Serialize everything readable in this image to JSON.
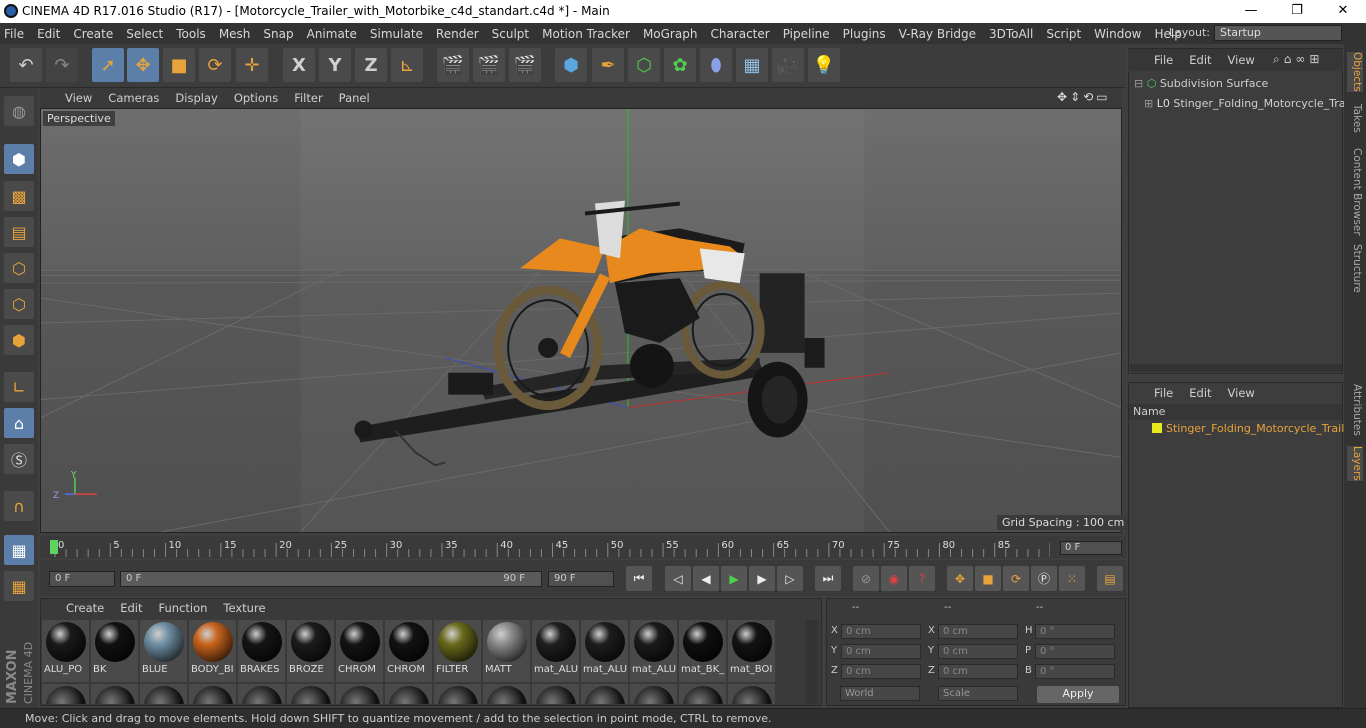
{
  "window": {
    "title": "CINEMA 4D R17.016 Studio (R17) - [Motorcycle_Trailer_with_Motorbike_c4d_standart.c4d *] - Main",
    "min": "—",
    "max": "❐",
    "close": "✕"
  },
  "menu": [
    "File",
    "Edit",
    "Create",
    "Select",
    "Tools",
    "Mesh",
    "Snap",
    "Animate",
    "Simulate",
    "Render",
    "Sculpt",
    "Motion Tracker",
    "MoGraph",
    "Character",
    "Pipeline",
    "Plugins",
    "V-Ray Bridge",
    "3DToAll",
    "Script",
    "Window",
    "Help"
  ],
  "layout": {
    "label": "Layout:",
    "value": "Startup"
  },
  "axes": {
    "x": "X",
    "y": "Y",
    "z": "Z"
  },
  "viewport": {
    "menu": [
      "View",
      "Cameras",
      "Display",
      "Options",
      "Filter",
      "Panel"
    ],
    "camera": "Perspective",
    "grid_spacing": "Grid Spacing : 100 cm",
    "axis_y": "Y",
    "axis_z": "Z"
  },
  "timeline": {
    "ticks": [
      "0",
      "5",
      "10",
      "15",
      "20",
      "25",
      "30",
      "35",
      "40",
      "45",
      "50",
      "55",
      "60",
      "65",
      "70",
      "75",
      "80",
      "85",
      "90"
    ],
    "current": "0 F",
    "start": "0 F",
    "range_start": "0 F",
    "range_end": "90 F",
    "end": "90 F"
  },
  "materials": {
    "menu": [
      "Create",
      "Edit",
      "Function",
      "Texture"
    ],
    "items": [
      {
        "name": "ALU_PO",
        "color": "#1a1a1a"
      },
      {
        "name": "BK",
        "color": "#111111"
      },
      {
        "name": "BLUE",
        "color": "#6f8fa3"
      },
      {
        "name": "BODY_BI",
        "color": "#c8641c"
      },
      {
        "name": "BRAKES",
        "color": "#151515"
      },
      {
        "name": "BROZE",
        "color": "#1c1c1c"
      },
      {
        "name": "CHROM",
        "color": "#141414"
      },
      {
        "name": "CHROM",
        "color": "#121212"
      },
      {
        "name": "FILTER",
        "color": "#6a6a1c"
      },
      {
        "name": "MATT",
        "color": "#8a8a8a"
      },
      {
        "name": "mat_ALU",
        "color": "#202020"
      },
      {
        "name": "mat_ALU",
        "color": "#1e1e1e"
      },
      {
        "name": "mat_ALU",
        "color": "#1b1b1b"
      },
      {
        "name": "mat_BK_",
        "color": "#0f0f0f"
      },
      {
        "name": "mat_BOI",
        "color": "#131313"
      }
    ]
  },
  "coords": {
    "hdr": [
      "--",
      "--",
      "--"
    ],
    "rows": [
      {
        "a": "X",
        "av": "0 cm",
        "b": "X",
        "bv": "0 cm",
        "c": "H",
        "cv": "0 °"
      },
      {
        "a": "Y",
        "av": "0 cm",
        "b": "Y",
        "bv": "0 cm",
        "c": "P",
        "cv": "0 °"
      },
      {
        "a": "Z",
        "av": "0 cm",
        "b": "Z",
        "bv": "0 cm",
        "c": "B",
        "cv": "0 °"
      }
    ],
    "world": "World",
    "scale": "Scale",
    "apply": "Apply"
  },
  "objects": {
    "menu": [
      "File",
      "Edit",
      "View"
    ],
    "items": [
      "Subdivision Surface",
      "Stinger_Folding_Motorcycle_Trai"
    ]
  },
  "layers": {
    "menu": [
      "File",
      "Edit",
      "View"
    ],
    "header": "Name",
    "items": [
      "Stinger_Folding_Motorcycle_Traile"
    ]
  },
  "sidetabs": [
    "Objects",
    "Takes",
    "Content Browser",
    "Structure",
    "Attributes",
    "Layers"
  ],
  "status": "Move: Click and drag to move elements. Hold down SHIFT to quantize movement / add to the selection in point mode, CTRL to remove.",
  "brand": {
    "maxon": "MAXON",
    "cinema": "CINEMA 4D"
  }
}
